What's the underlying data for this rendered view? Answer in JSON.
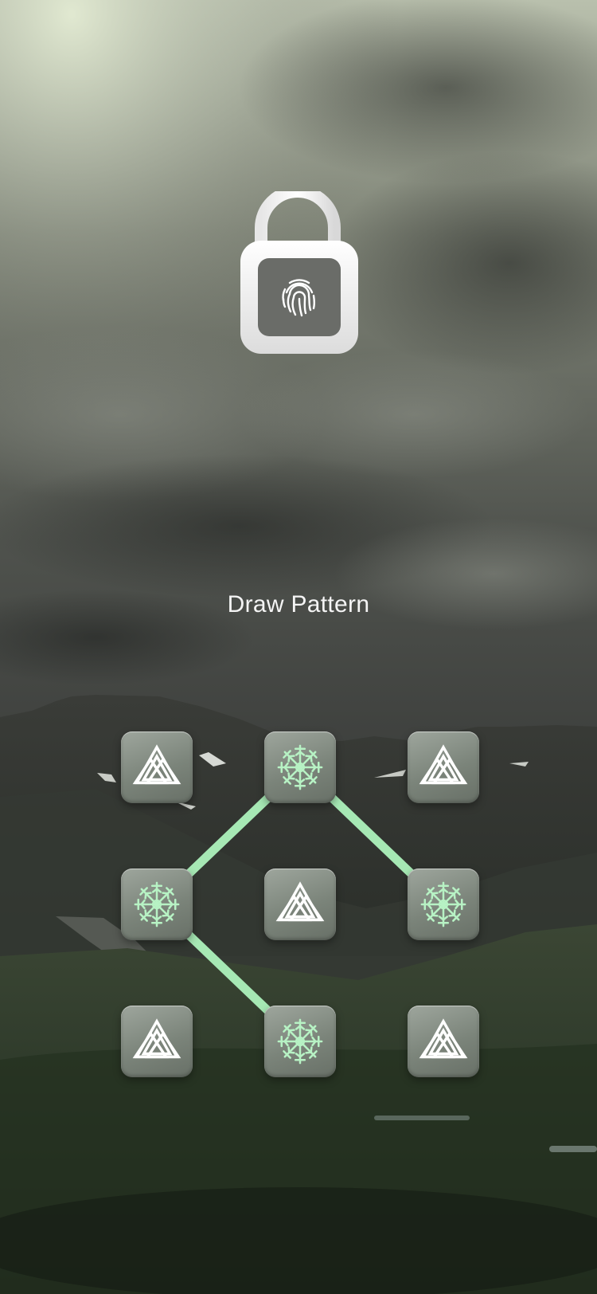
{
  "screen": {
    "title": "Draw Pattern"
  },
  "lock": {
    "icon": "unlocked-padlock-fingerprint-icon",
    "state": "unlocked"
  },
  "pattern": {
    "rows": 3,
    "cols": 3,
    "nodes": [
      {
        "id": 1,
        "icon": "valknut-icon",
        "selected": false
      },
      {
        "id": 2,
        "icon": "aegishjalmur-icon",
        "selected": true
      },
      {
        "id": 3,
        "icon": "valknut-icon",
        "selected": false
      },
      {
        "id": 4,
        "icon": "aegishjalmur-icon",
        "selected": true
      },
      {
        "id": 5,
        "icon": "valknut-icon",
        "selected": false
      },
      {
        "id": 6,
        "icon": "aegishjalmur-icon",
        "selected": true
      },
      {
        "id": 7,
        "icon": "valknut-icon",
        "selected": false
      },
      {
        "id": 8,
        "icon": "aegishjalmur-icon",
        "selected": true
      },
      {
        "id": 9,
        "icon": "valknut-icon",
        "selected": false
      }
    ],
    "connected_path": [
      6,
      2,
      4,
      8
    ],
    "line_color": "#a6e8b4",
    "selected_icon_color": "#b7f2c4",
    "icon_color": "#ffffff"
  }
}
